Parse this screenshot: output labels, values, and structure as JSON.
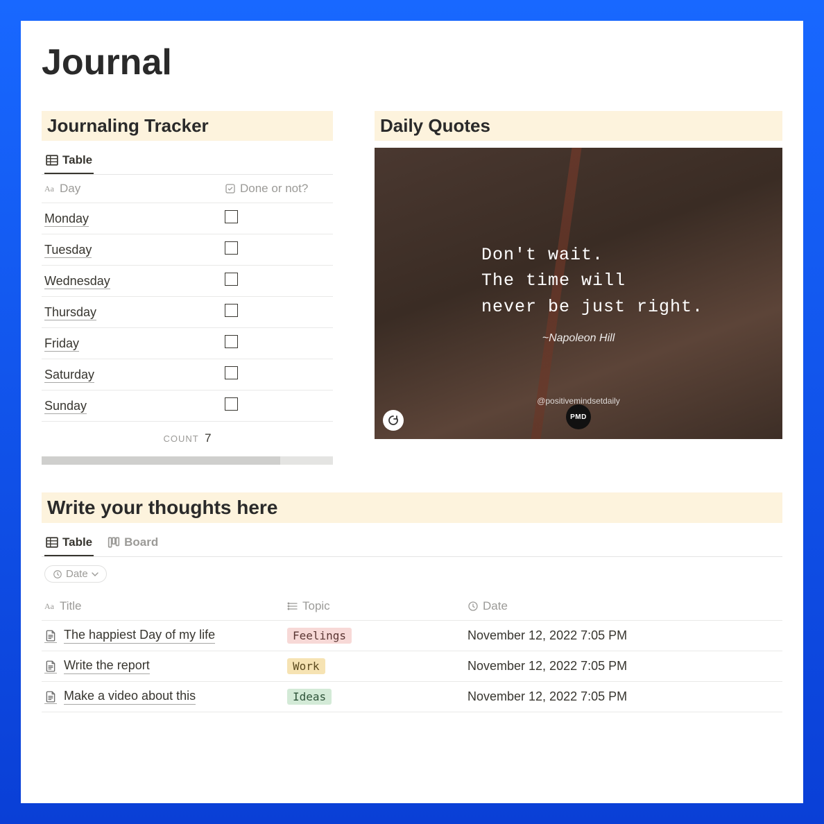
{
  "page": {
    "title": "Journal"
  },
  "tracker": {
    "header": "Journaling Tracker",
    "tab_table": "Table",
    "col_day": "Day",
    "col_done": "Done or not?",
    "rows": [
      {
        "day": "Monday"
      },
      {
        "day": "Tuesday"
      },
      {
        "day": "Wednesday"
      },
      {
        "day": "Thursday"
      },
      {
        "day": "Friday"
      },
      {
        "day": "Saturday"
      },
      {
        "day": "Sunday"
      }
    ],
    "count_label": "COUNT",
    "count_value": "7"
  },
  "quotes": {
    "header": "Daily Quotes",
    "line1": "Don't wait.",
    "line2": "The time will",
    "line3": "never be just right.",
    "author": "~Napoleon Hill",
    "handle": "@positivemindsetdaily",
    "badge": "PMD"
  },
  "thoughts": {
    "header": "Write your thoughts here",
    "tab_table": "Table",
    "tab_board": "Board",
    "sort_label": "Date",
    "col_title": "Title",
    "col_topic": "Topic",
    "col_date": "Date",
    "rows": [
      {
        "title": "The happiest Day of my life",
        "topic": "Feelings",
        "topic_class": "tag-feelings",
        "date": "November 12, 2022 7:05 PM"
      },
      {
        "title": "Write the report",
        "topic": "Work",
        "topic_class": "tag-work",
        "date": "November 12, 2022 7:05 PM"
      },
      {
        "title": "Make a video about this",
        "topic": "Ideas",
        "topic_class": "tag-ideas",
        "date": "November 12, 2022 7:05 PM"
      }
    ]
  }
}
